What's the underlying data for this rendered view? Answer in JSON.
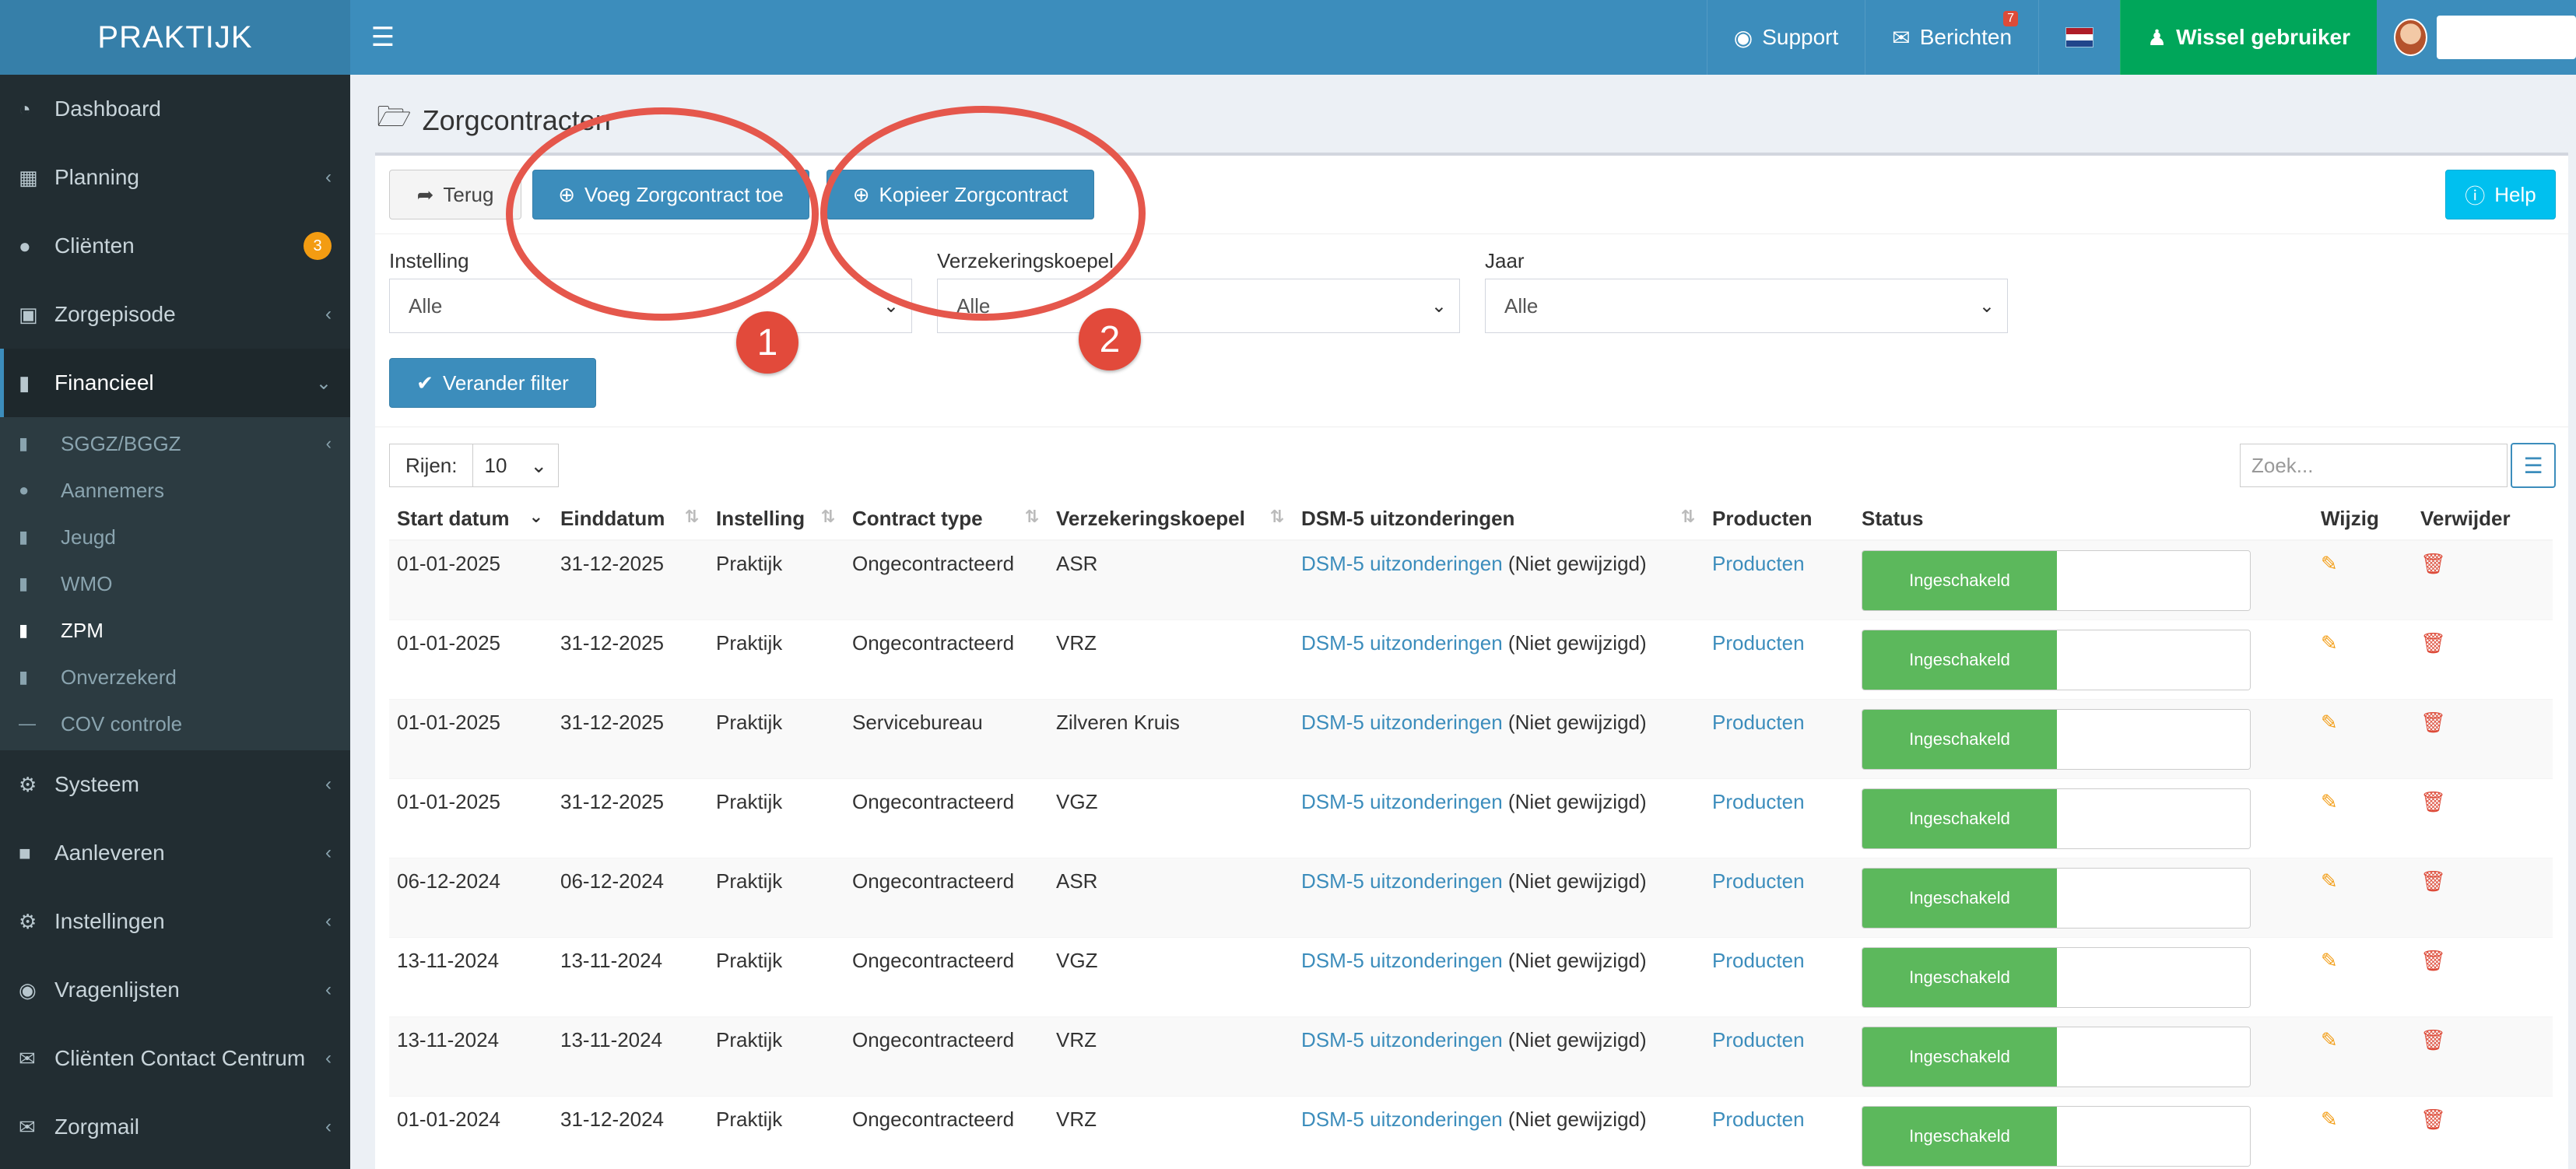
{
  "header": {
    "logo": "PRAKTIJK",
    "support": "Support",
    "messages": "Berichten",
    "messages_count": "7",
    "switch_user": "Wissel gebruiker"
  },
  "sidebar": {
    "items": [
      {
        "label": "Dashboard",
        "icon": "dashboard-icon"
      },
      {
        "label": "Planning",
        "icon": "calendar-icon"
      },
      {
        "label": "Cliënten",
        "icon": "user-icon",
        "badge": "3"
      },
      {
        "label": "Zorgepisode",
        "icon": "camera-icon"
      },
      {
        "label": "Financieel",
        "icon": "book-icon"
      }
    ],
    "financieel_sub": [
      {
        "label": "SGGZ/BGGZ"
      },
      {
        "label": "Aannemers"
      },
      {
        "label": "Jeugd"
      },
      {
        "label": "WMO"
      },
      {
        "label": "ZPM"
      },
      {
        "label": "Onverzekerd"
      },
      {
        "label": "COV controle"
      }
    ],
    "items_after": [
      {
        "label": "Systeem"
      },
      {
        "label": "Aanleveren"
      },
      {
        "label": "Instellingen"
      },
      {
        "label": "Vragenlijsten"
      },
      {
        "label": "Cliënten Contact Centrum"
      },
      {
        "label": "Zorgmail"
      }
    ]
  },
  "page": {
    "title": "Zorgcontracten",
    "back": "Terug",
    "add": "Voeg Zorgcontract toe",
    "copy": "Kopieer Zorgcontract",
    "help": "Help",
    "filters": {
      "instelling_label": "Instelling",
      "instelling_value": "Alle",
      "koepel_label": "Verzekeringskoepel",
      "koepel_value": "Alle",
      "jaar_label": "Jaar",
      "jaar_value": "Alle",
      "apply": "Verander filter"
    },
    "rows_label": "Rijen:",
    "rows_value": "10",
    "search_placeholder": "Zoek..."
  },
  "annotations": {
    "one": "1",
    "two": "2"
  },
  "table": {
    "headers": [
      "Start datum",
      "Einddatum",
      "Instelling",
      "Contract type",
      "Verzekeringskoepel",
      "DSM-5 uitzonderingen",
      "Producten",
      "Status",
      "Wijzig",
      "Verwijder"
    ],
    "dsm_link": "DSM-5 uitzonderingen",
    "dsm_suffix": " (Niet gewijzigd)",
    "products_link": "Producten",
    "status_label": "Ingeschakeld",
    "rows": [
      {
        "start": "01-01-2025",
        "end": "31-12-2025",
        "inst": "Praktijk",
        "type": "Ongecontracteerd",
        "koepel": "ASR"
      },
      {
        "start": "01-01-2025",
        "end": "31-12-2025",
        "inst": "Praktijk",
        "type": "Ongecontracteerd",
        "koepel": "VRZ"
      },
      {
        "start": "01-01-2025",
        "end": "31-12-2025",
        "inst": "Praktijk",
        "type": "Servicebureau",
        "koepel": "Zilveren Kruis"
      },
      {
        "start": "01-01-2025",
        "end": "31-12-2025",
        "inst": "Praktijk",
        "type": "Ongecontracteerd",
        "koepel": "VGZ"
      },
      {
        "start": "06-12-2024",
        "end": "06-12-2024",
        "inst": "Praktijk",
        "type": "Ongecontracteerd",
        "koepel": "ASR"
      },
      {
        "start": "13-11-2024",
        "end": "13-11-2024",
        "inst": "Praktijk",
        "type": "Ongecontracteerd",
        "koepel": "VGZ"
      },
      {
        "start": "13-11-2024",
        "end": "13-11-2024",
        "inst": "Praktijk",
        "type": "Ongecontracteerd",
        "koepel": "VRZ"
      },
      {
        "start": "01-01-2024",
        "end": "31-12-2024",
        "inst": "Praktijk",
        "type": "Ongecontracteerd",
        "koepel": "VRZ"
      }
    ]
  }
}
